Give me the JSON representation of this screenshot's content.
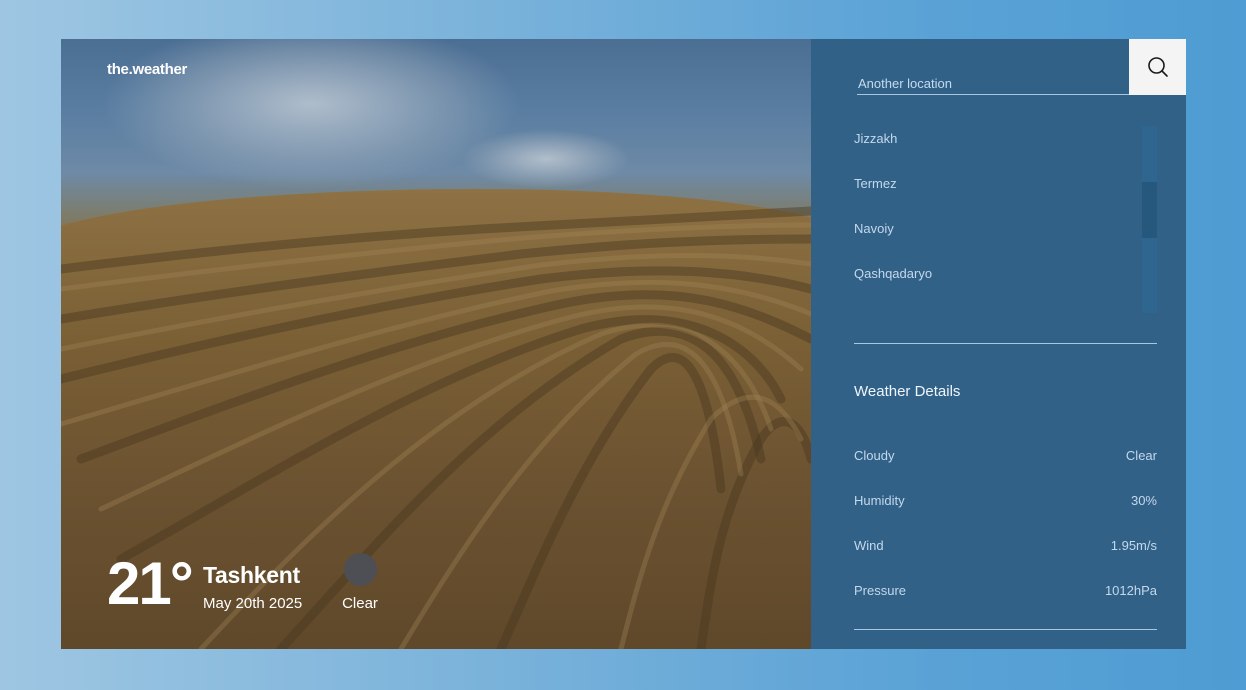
{
  "app": {
    "logo": "the.weather"
  },
  "current": {
    "temperature": "21°",
    "city": "Tashkent",
    "date": "May 20th 2025",
    "condition": "Clear",
    "condition_icon": "weather-condition-icon"
  },
  "search": {
    "placeholder": "Another location",
    "icon": "search-icon"
  },
  "locations": [
    {
      "label": "Jizzakh"
    },
    {
      "label": "Termez"
    },
    {
      "label": "Navoiy"
    },
    {
      "label": "Qashqadaryo"
    }
  ],
  "details": {
    "title": "Weather Details",
    "rows": [
      {
        "label": "Cloudy",
        "value": "Clear"
      },
      {
        "label": "Humidity",
        "value": "30%"
      },
      {
        "label": "Wind",
        "value": "1.95m/s"
      },
      {
        "label": "Pressure",
        "value": "1012hPa"
      }
    ]
  },
  "colors": {
    "panel": "#326187",
    "search_button": "#f4f4f4",
    "page_gradient_start": "#9ec6e2",
    "page_gradient_end": "#4e9cd3"
  }
}
